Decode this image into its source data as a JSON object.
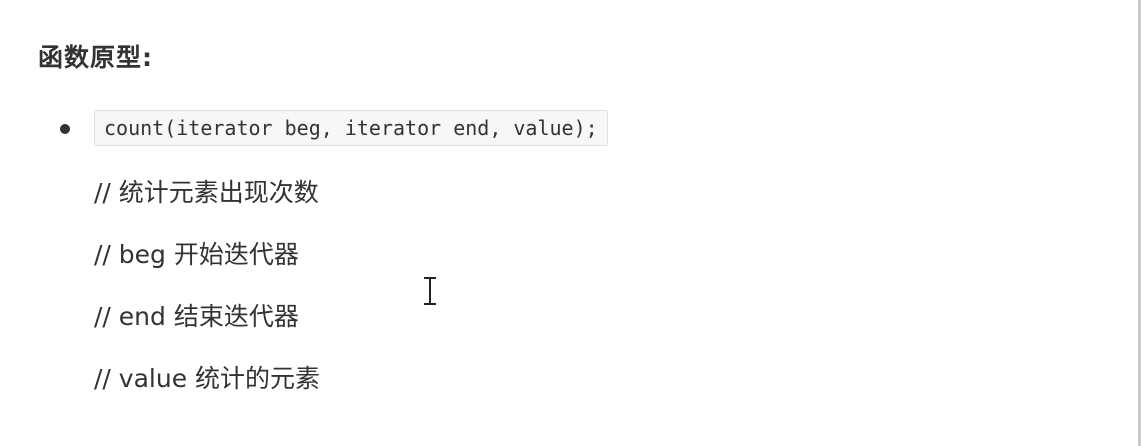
{
  "heading": "函数原型:",
  "prototype": {
    "code": "count(iterator beg, iterator end, value);"
  },
  "comments": [
    "// 统计元素出现次数",
    "// beg 开始迭代器",
    "// end 结束迭代器",
    "// value 统计的元素"
  ],
  "icons": {
    "cursor": "text-cursor-icon",
    "bullet": "bullet-icon"
  },
  "colors": {
    "text": "#333333",
    "code_background": "#f7f7f7",
    "code_border": "#e0e0e0"
  }
}
